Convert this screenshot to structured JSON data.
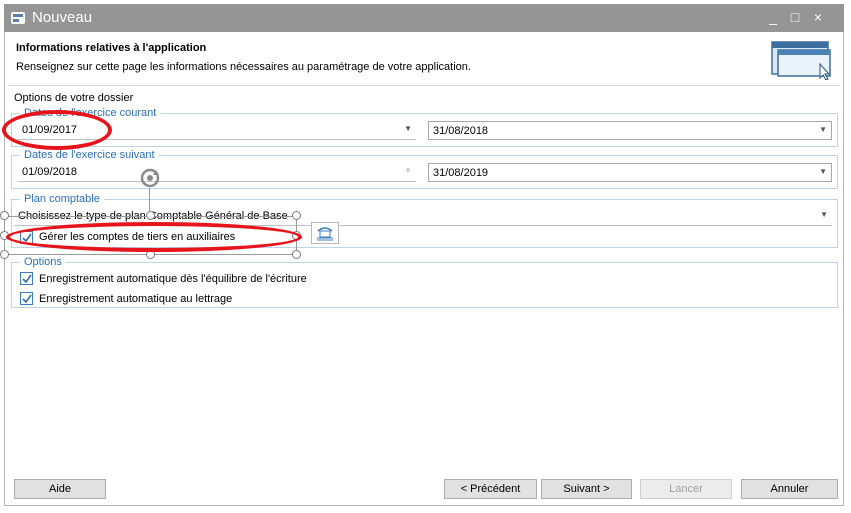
{
  "window": {
    "title": "Nouveau",
    "controls": [
      "_",
      "□",
      "×"
    ]
  },
  "header": {
    "title": "Informations relatives à l'application",
    "subtitle": "Renseignez sur cette page les informations nécessaires au paramétrage de votre application."
  },
  "options_label": "Options de votre dossier",
  "exercice_courant": {
    "legend": "Dates de l'exercice courant",
    "start": "01/09/2017",
    "end": "31/08/2018"
  },
  "exercice_suivant": {
    "legend": "Dates de l'exercice suivant",
    "start": "01/09/2018",
    "end": "31/08/2019"
  },
  "plan_comptable": {
    "legend": "Plan comptable",
    "combo_value": "Choisissez le type de plan Comptable Général de Base",
    "tiers_checkbox_label": "Gérer les comptes de tiers en auxiliaires",
    "tiers_checked": true
  },
  "options": {
    "legend": "Options",
    "items": [
      {
        "label": "Enregistrement automatique dès l'équilibre de l'écriture",
        "checked": true
      },
      {
        "label": "Enregistrement automatique au lettrage",
        "checked": true
      }
    ]
  },
  "buttons": {
    "help": "Aide",
    "prev": "< Précédent",
    "next": "Suivant >",
    "launch": "Lancer",
    "cancel": "Annuler"
  },
  "colors": {
    "titlebar": "#959595",
    "accent": "#2b6fb6",
    "annotation": "#e8141c"
  }
}
